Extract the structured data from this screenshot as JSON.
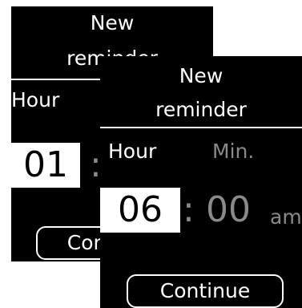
{
  "back_screen": {
    "title_line1": "New",
    "title_line2": "reminder",
    "hour_label": "Hour",
    "hour_value": "01",
    "colon": ":",
    "continue_label": "Continue"
  },
  "front_screen": {
    "title_line1": "New",
    "title_line2": "reminder",
    "hour_label": "Hour",
    "minute_label": "Min.",
    "hour_value": "06",
    "colon": ":",
    "minute_value": "00",
    "ampm": "am",
    "continue_label": "Continue"
  },
  "colors": {
    "background": "#000000",
    "text": "#ffffff",
    "inactive_text": "#8a8a8a",
    "selected_field_bg": "#ffffff"
  }
}
